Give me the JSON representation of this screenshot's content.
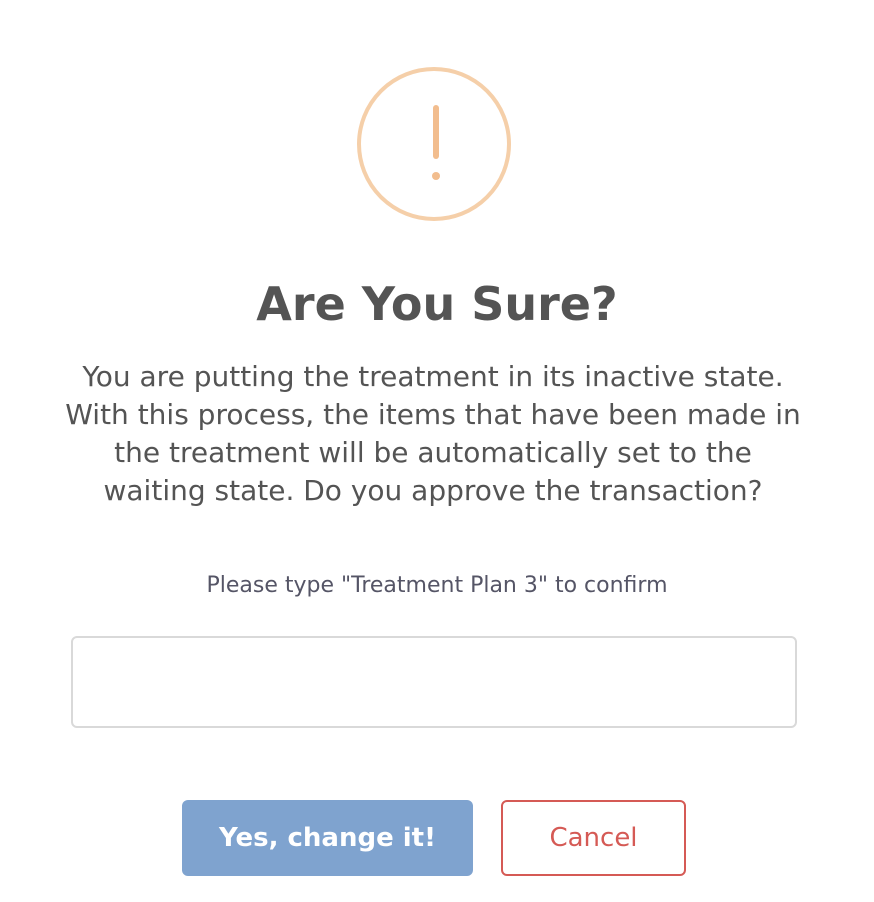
{
  "dialog": {
    "icon": "warning-exclamation-icon",
    "title": "Are You Sure?",
    "message": "You are putting the treatment in its inactive state. With this process, the items that have been made in the treatment will be automatically set to the waiting state. Do you approve the transaction?",
    "confirm_prompt": "Please type \"Treatment Plan 3\" to confirm",
    "input_value": "",
    "input_placeholder": "",
    "confirm_button_label": "Yes, change it!",
    "cancel_button_label": "Cancel"
  },
  "colors": {
    "icon_accent": "#f2bd8e",
    "title_text": "#545454",
    "confirm_button": "#7fa3cf",
    "cancel_button": "#d55a55"
  }
}
